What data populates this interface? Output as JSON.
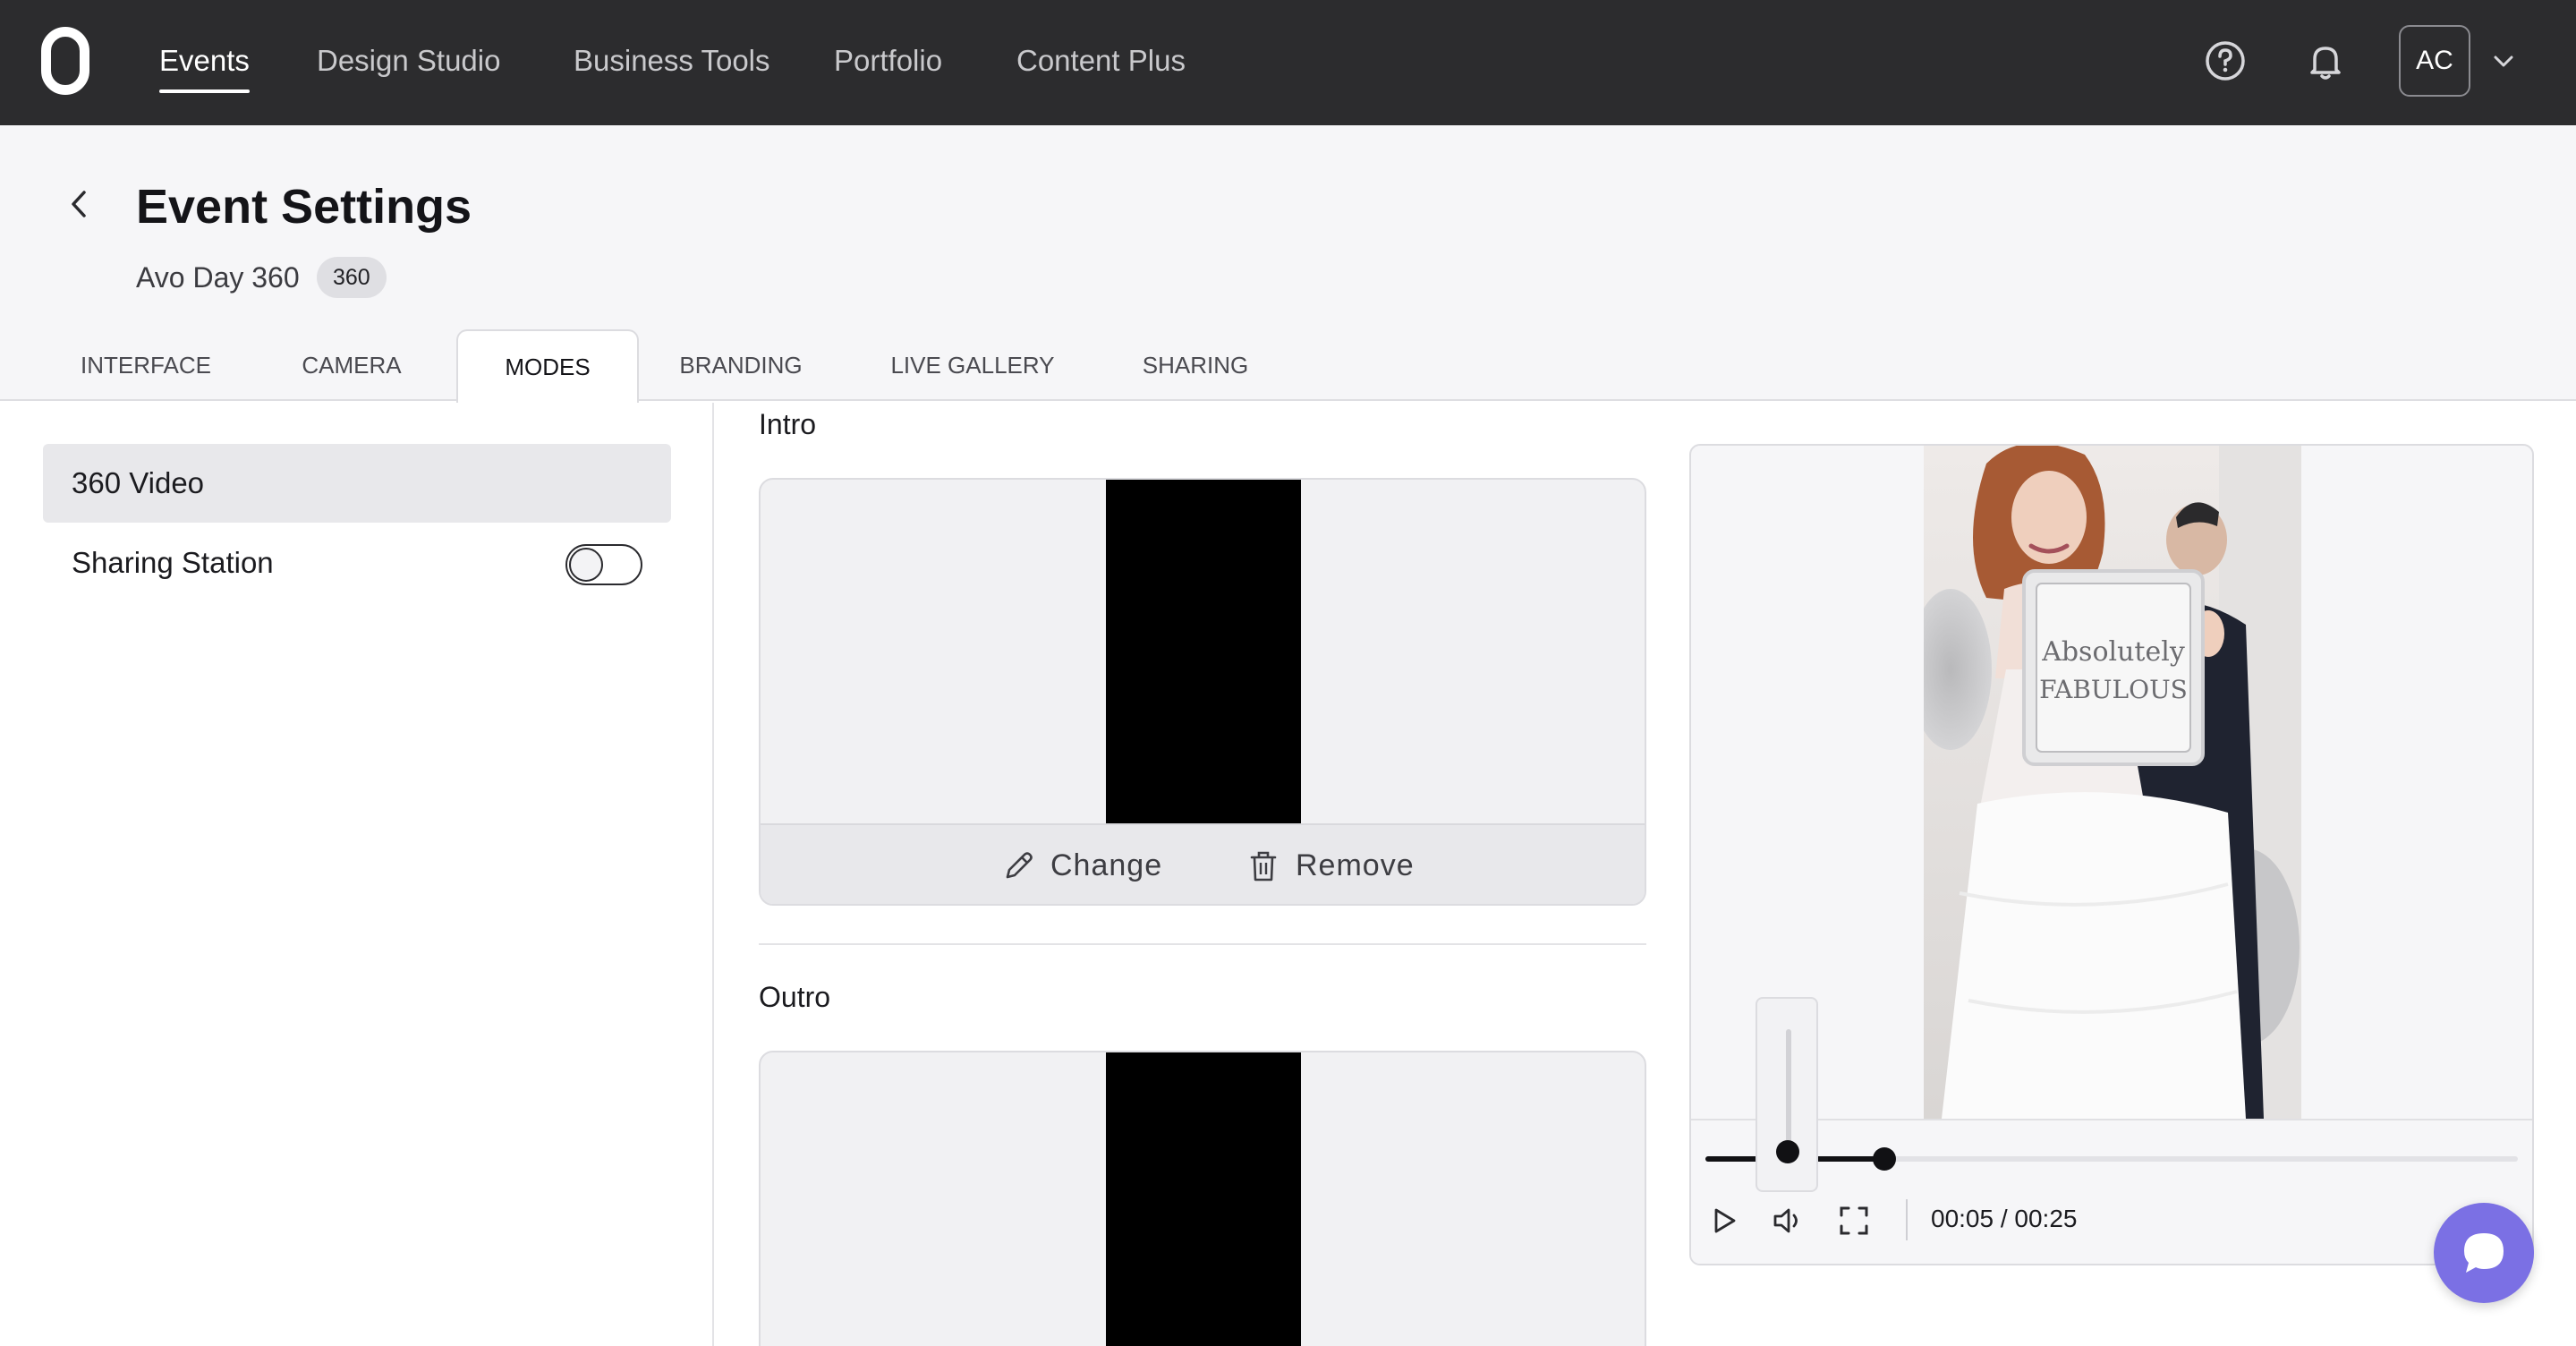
{
  "topnav": {
    "items": [
      "Events",
      "Design Studio",
      "Business Tools",
      "Portfolio",
      "Content Plus"
    ],
    "active": "Events",
    "help_icon": "help-circle-icon",
    "notifications_icon": "bell-icon",
    "avatar_initials": "AC",
    "avatar_menu_icon": "chevron-down-icon"
  },
  "header": {
    "back_icon": "chevron-left-icon",
    "title": "Event Settings",
    "event_name": "Avo Day 360",
    "event_badge": "360"
  },
  "tabs": [
    "INTERFACE",
    "CAMERA",
    "MODES",
    "BRANDING",
    "LIVE GALLERY",
    "SHARING"
  ],
  "active_tab": "MODES",
  "modes": {
    "items": [
      {
        "label": "360 Video",
        "selected": true
      },
      {
        "label": "Sharing Station",
        "selected": false,
        "toggle_on": false
      }
    ]
  },
  "intro": {
    "label": "Intro",
    "change_label": "Change",
    "remove_label": "Remove"
  },
  "outro": {
    "label": "Outro"
  },
  "player": {
    "sign_text_line1": "Absolutely",
    "sign_text_line2": "FABULOUS",
    "progress_fraction": 0.22,
    "volume_fraction": 0.0,
    "time_display": "00:05 / 00:25",
    "play_icon": "play-icon",
    "volume_icon": "volume-icon",
    "fullscreen_icon": "fullscreen-icon"
  },
  "chat_icon": "chat-bubble-icon",
  "colors": {
    "nav_bg": "#2c2c2e",
    "header_bg": "#f6f6f8",
    "chat_accent": "#7b70e4",
    "selected_mode_bg": "#e8e8eb"
  }
}
